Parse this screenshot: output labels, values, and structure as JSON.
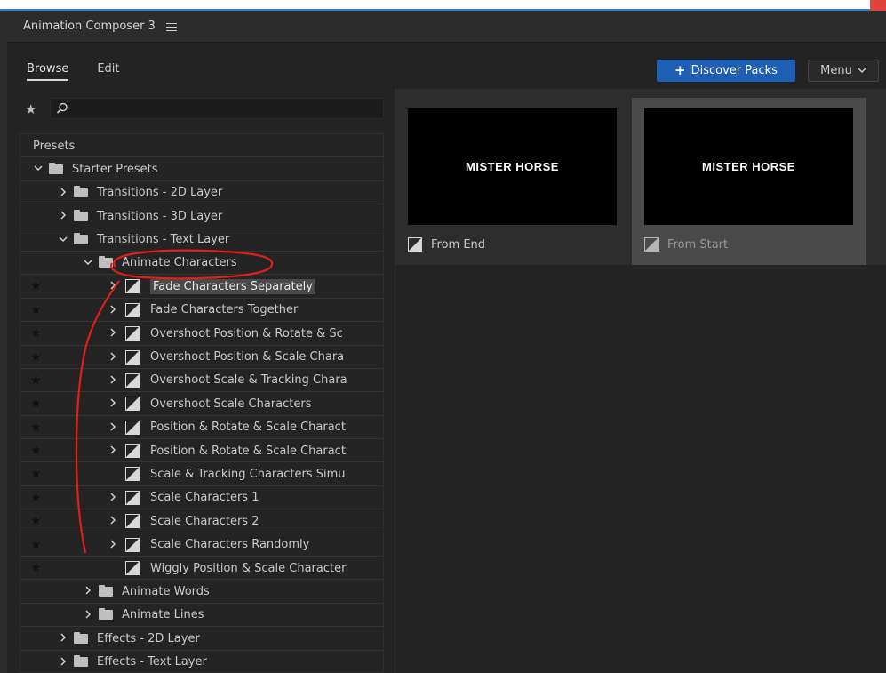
{
  "window": {
    "title": "Animation Composer 3"
  },
  "tabs": [
    {
      "label": "Browse",
      "active": true
    },
    {
      "label": "Edit",
      "active": false
    }
  ],
  "toolbar": {
    "discover_label": "Discover Packs",
    "menu_label": "Menu"
  },
  "search": {
    "value": "",
    "placeholder": ""
  },
  "tree": {
    "header": "Presets",
    "rows": [
      {
        "label": "Starter Presets",
        "chevron": "down",
        "icon": "folder"
      },
      {
        "label": "Transitions - 2D Layer",
        "chevron": "right",
        "icon": "folder"
      },
      {
        "label": "Transitions - 3D Layer",
        "chevron": "right",
        "icon": "folder"
      },
      {
        "label": "Transitions - Text Layer",
        "chevron": "down",
        "icon": "folder"
      },
      {
        "label": "Animate Characters",
        "chevron": "down",
        "icon": "folder"
      },
      {
        "label": "Fade Characters Separately",
        "chevron": "right",
        "icon": "preset",
        "star": true,
        "highlight": true
      },
      {
        "label": "Fade Characters Together",
        "chevron": "right",
        "icon": "preset",
        "star": true
      },
      {
        "label": "Overshoot Position & Rotate & Sc",
        "chevron": "right",
        "icon": "preset",
        "star": true
      },
      {
        "label": "Overshoot Position & Scale Chara",
        "chevron": "right",
        "icon": "preset",
        "star": true
      },
      {
        "label": "Overshoot Scale & Tracking Chara",
        "chevron": "right",
        "icon": "preset",
        "star": true
      },
      {
        "label": "Overshoot Scale Characters",
        "chevron": "right",
        "icon": "preset",
        "star": true
      },
      {
        "label": "Position & Rotate & Scale Charact",
        "chevron": "right",
        "icon": "preset",
        "star": true
      },
      {
        "label": "Position & Rotate & Scale Charact",
        "chevron": "right",
        "icon": "preset",
        "star": true
      },
      {
        "label": "Scale & Tracking Characters Simu",
        "chevron": "none",
        "icon": "preset",
        "star": true
      },
      {
        "label": "Scale Characters 1",
        "chevron": "right",
        "icon": "preset",
        "star": true
      },
      {
        "label": "Scale Characters 2",
        "chevron": "right",
        "icon": "preset",
        "star": true
      },
      {
        "label": "Scale Characters Randomly",
        "chevron": "right",
        "icon": "preset",
        "star": true
      },
      {
        "label": "Wiggly Position & Scale Character",
        "chevron": "none",
        "icon": "preset",
        "star": true
      },
      {
        "label": "Animate Words",
        "chevron": "right",
        "icon": "folder"
      },
      {
        "label": "Animate Lines",
        "chevron": "right",
        "icon": "folder"
      },
      {
        "label": "Effects - 2D Layer",
        "chevron": "right",
        "icon": "folder"
      },
      {
        "label": "Effects - Text Layer",
        "chevron": "right",
        "icon": "folder"
      }
    ]
  },
  "previews": [
    {
      "thumb_text": "MISTER HORSE",
      "caption": "From End",
      "selected": false
    },
    {
      "thumb_text": "MISTER HORSE",
      "caption": "From Start",
      "selected": true
    }
  ],
  "colors": {
    "accent": "#1e5fb4",
    "annotation": "#e0201a",
    "background": "#232323"
  }
}
